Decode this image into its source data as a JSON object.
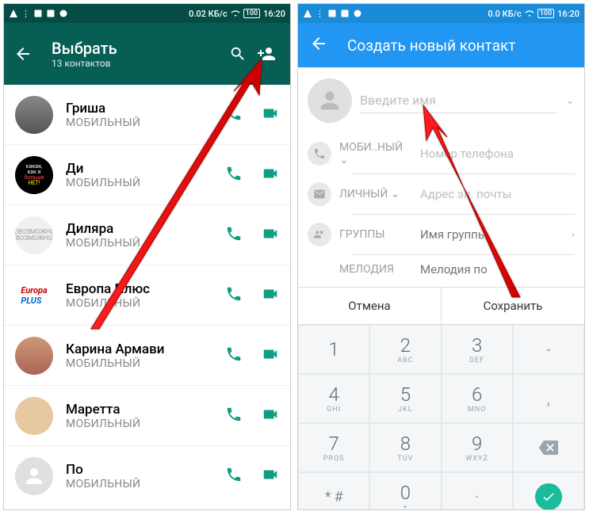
{
  "left": {
    "status": {
      "data": "0.02 КБ/с",
      "battery": "100",
      "time": "16:20"
    },
    "title": "Выбрать",
    "subtitle": "13 контактов",
    "mobile_label": "МОБИЛЬНЫЙ",
    "contacts": [
      {
        "name": "Гриша"
      },
      {
        "name": "Ди"
      },
      {
        "name": "Диляра"
      },
      {
        "name": "Европа Плюс"
      },
      {
        "name": "Карина Армави"
      },
      {
        "name": "Маретта"
      },
      {
        "name": "По"
      }
    ]
  },
  "right": {
    "status": {
      "data": "0.0 КБ/с",
      "battery": "100",
      "time": "16:20"
    },
    "title": "Создать новый контакт",
    "name_placeholder": "Введите имя",
    "fields": {
      "mobile_label": "МОБИ..НЫЙ",
      "mobile_placeholder": "Номер телефона",
      "personal_label": "ЛИЧНЫЙ",
      "email_placeholder": "Адрес эл. почты",
      "groups_label": "ГРУППЫ",
      "groups_value": "Имя группы",
      "ringtone_label": "МЕЛОДИЯ",
      "ringtone_value": "Мелодия по"
    },
    "cancel": "Отмена",
    "save": "Сохранить",
    "keys": {
      "r1": [
        "1",
        "2",
        "3",
        "-"
      ],
      "r1s": [
        "",
        "ABC",
        "DEF",
        ""
      ],
      "r2": [
        "4",
        "5",
        "6",
        ","
      ],
      "r2s": [
        "GHI",
        "JKL",
        "MNO",
        ""
      ],
      "r3": [
        "7",
        "8",
        "9",
        "⌫"
      ],
      "r3s": [
        "PRQS",
        "TUV",
        "WXYZ",
        ""
      ],
      "r4": [
        "* #",
        "0",
        "·",
        ""
      ],
      "r4s": [
        "",
        "+",
        "",
        ""
      ]
    }
  }
}
